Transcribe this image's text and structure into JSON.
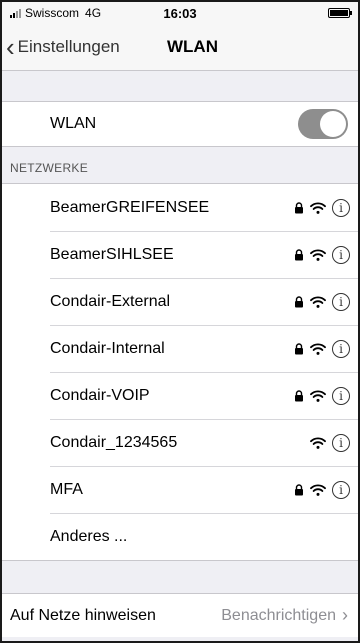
{
  "status": {
    "carrier": "Swisscom",
    "network": "4G",
    "time": "16:03"
  },
  "nav": {
    "back_label": "Einstellungen",
    "title": "WLAN"
  },
  "wlan": {
    "label": "WLAN",
    "enabled": true
  },
  "networks_header": "NETZWERKE",
  "networks": [
    {
      "name": "BeamerGREIFENSEE",
      "locked": true
    },
    {
      "name": "BeamerSIHLSEE",
      "locked": true
    },
    {
      "name": "Condair-External",
      "locked": true
    },
    {
      "name": "Condair-Internal",
      "locked": true
    },
    {
      "name": "Condair-VOIP",
      "locked": true
    },
    {
      "name": "Condair_1234565",
      "locked": false
    },
    {
      "name": "MFA",
      "locked": true
    }
  ],
  "other_label": "Anderes ...",
  "notify": {
    "label": "Auf Netze hinweisen",
    "value": "Benachrichtigen"
  },
  "icons": {
    "lock": "lock-icon",
    "wifi": "wifi-icon",
    "info": "info-icon",
    "back": "chevron-left-icon",
    "disclosure": "chevron-right-icon"
  },
  "colors": {
    "toggle_on": "#8e8e8e",
    "secondary_text": "#8e8e93"
  }
}
